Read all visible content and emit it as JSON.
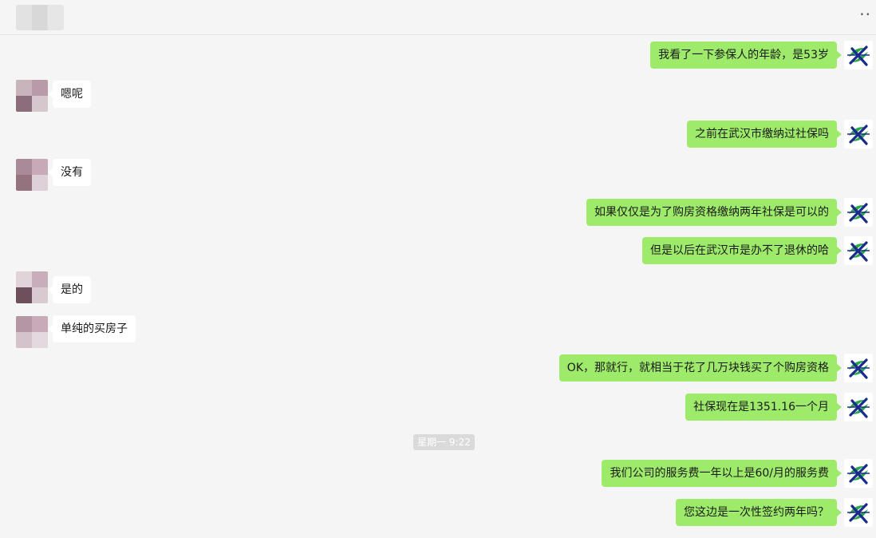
{
  "header": {
    "title": "",
    "more_label": "··"
  },
  "colors": {
    "outgoing_bubble": "#9eea6a",
    "incoming_bubble": "#ffffff",
    "background": "#f5f5f5"
  },
  "messages": [
    {
      "side": "out",
      "text": "我看了一下参保人的年龄，是53岁"
    },
    {
      "side": "in",
      "text": "嗯呢"
    },
    {
      "side": "out",
      "text": "之前在武汉市缴纳过社保吗"
    },
    {
      "side": "in",
      "text": "没有"
    },
    {
      "side": "out",
      "text": "如果仅仅是为了购房资格缴纳两年社保是可以的"
    },
    {
      "side": "out",
      "text": "但是以后在武汉市是办不了退休的哈"
    },
    {
      "side": "in",
      "text": "是的"
    },
    {
      "side": "in",
      "text": "单纯的买房子"
    },
    {
      "side": "out",
      "text": "OK，那就行，就相当于花了几万块钱买了个购房资格"
    },
    {
      "side": "out",
      "text": "社保现在是1351.16一个月"
    },
    {
      "side": "out",
      "text": "我们公司的服务费一年以上是60/月的服务费"
    },
    {
      "side": "out",
      "text": "您这边是一次性签约两年吗？"
    }
  ],
  "timestamp": "星期一 9:22",
  "self_avatar_icon": "company-logo-icon"
}
